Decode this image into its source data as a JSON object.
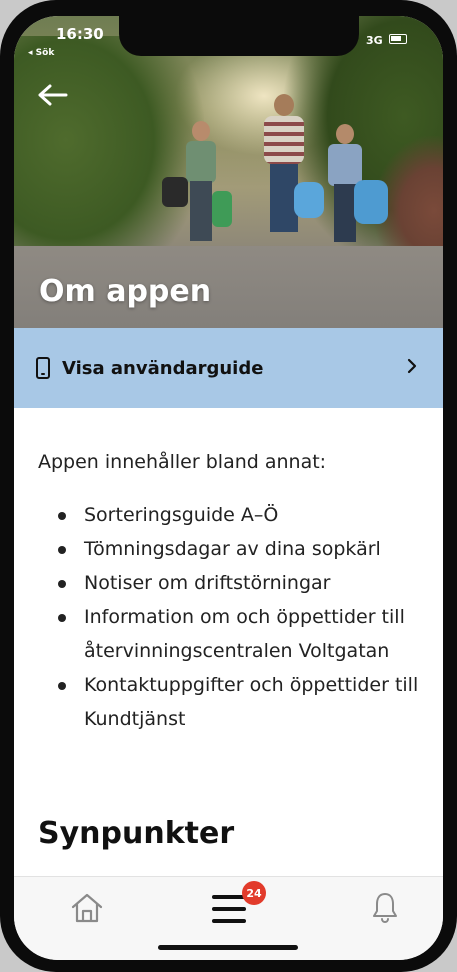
{
  "status_bar": {
    "time": "16:30",
    "back_label": "◂ Sök",
    "network": "3G"
  },
  "header": {
    "title": "Om appen"
  },
  "guide": {
    "label": "Visa användarguide"
  },
  "content": {
    "intro": "Appen innehåller bland annat:",
    "bullets": [
      "Sorteringsguide A–Ö",
      "Tömningsdagar av dina sopkärl",
      "Notiser om driftstörningar",
      "Information om och öppettider till återvinningscentralen Voltgatan",
      "Kontaktuppgifter och öppettider till Kundtjänst"
    ],
    "section_title": "Synpunkter"
  },
  "nav": {
    "badge_count": "24",
    "icons": [
      "home-icon",
      "menu-icon",
      "bell-icon"
    ]
  },
  "colors": {
    "guide_bar": "#a8c8e6",
    "badge": "#e23b2b",
    "accent_text": "#111111"
  }
}
